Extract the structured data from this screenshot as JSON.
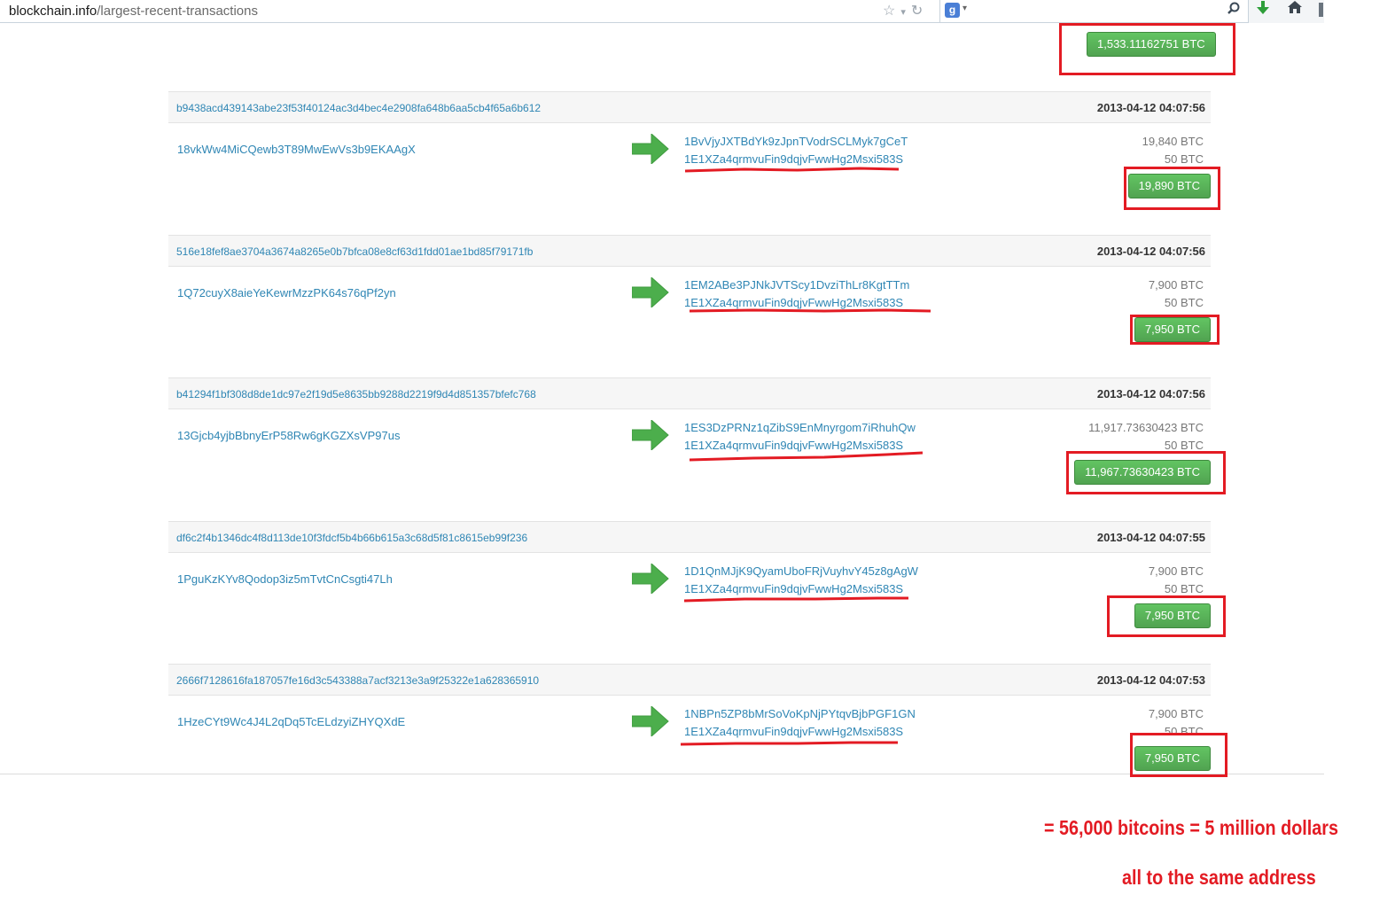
{
  "browser": {
    "url_host": "blockchain.info",
    "url_path": "/largest-recent-transactions",
    "search_engine_icon": "google-icon",
    "search_placeholder": ""
  },
  "first_total": "1,533.11162751 BTC",
  "transactions": [
    {
      "hash": "b9438acd439143abe23f53f40124ac3d4bec4e2908fa648b6aa5cb4f65a6b612",
      "time": "2013-04-12 04:07:56",
      "from": "18vkWw4MiCQewb3T89MwEwVs3b9EKAAgX",
      "to": [
        "1BvVjyJXTBdYk9zJpnTVodrSCLMyk7gCeT",
        "1E1XZa4qrmvuFin9dqjvFwwHg2Msxi583S"
      ],
      "amounts": [
        "19,840 BTC",
        "50 BTC"
      ],
      "total": "19,890 BTC"
    },
    {
      "hash": "516e18fef8ae3704a3674a8265e0b7bfca08e8cf63d1fdd01ae1bd85f79171fb",
      "time": "2013-04-12 04:07:56",
      "from": "1Q72cuyX8aieYeKewrMzzPK64s76qPf2yn",
      "to": [
        "1EM2ABe3PJNkJVTScy1DvziThLr8KgtTTm",
        "1E1XZa4qrmvuFin9dqjvFwwHg2Msxi583S"
      ],
      "amounts": [
        "7,900 BTC",
        "50 BTC"
      ],
      "total": "7,950 BTC"
    },
    {
      "hash": "b41294f1bf308d8de1dc97e2f19d5e8635bb9288d2219f9d4d851357bfefc768",
      "time": "2013-04-12 04:07:56",
      "from": "13Gjcb4yjbBbnyErP58Rw6gKGZXsVP97us",
      "to": [
        "1ES3DzPRNz1qZibS9EnMnyrgom7iRhuhQw",
        "1E1XZa4qrmvuFin9dqjvFwwHg2Msxi583S"
      ],
      "amounts": [
        "11,917.73630423 BTC",
        "50 BTC"
      ],
      "total": "11,967.73630423 BTC"
    },
    {
      "hash": "df6c2f4b1346dc4f8d113de10f3fdcf5b4b66b615a3c68d5f81c8615eb99f236",
      "time": "2013-04-12 04:07:55",
      "from": "1PguKzKYv8Qodop3iz5mTvtCnCsgti47Lh",
      "to": [
        "1D1QnMJjK9QyamUboFRjVuyhvY45z8gAgW",
        "1E1XZa4qrmvuFin9dqjvFwwHg2Msxi583S"
      ],
      "amounts": [
        "7,900 BTC",
        "50 BTC"
      ],
      "total": "7,950 BTC"
    },
    {
      "hash": "2666f7128616fa187057fe16d3c543388a7acf3213e3a9f25322e1a628365910",
      "time": "2013-04-12 04:07:53",
      "from": "1HzeCYt9Wc4J4L2qDq5TcELdzyiZHYQXdE",
      "to": [
        "1NBPn5ZP8bMrSoVoKpNjPYtqvBjbPGF1GN",
        "1E1XZa4qrmvuFin9dqjvFwwHg2Msxi583S"
      ],
      "amounts": [
        "7,900 BTC",
        "50 BTC"
      ],
      "total": "7,950 BTC"
    }
  ],
  "annotations": {
    "caption_1": "= 56,000 bitcoins = 5  million dollars",
    "caption_2": "all to the same address",
    "color": "#e31b23"
  },
  "colors": {
    "link": "#2f86b4",
    "button_green": "#51a351",
    "arrow_green": "#4cae4c"
  }
}
